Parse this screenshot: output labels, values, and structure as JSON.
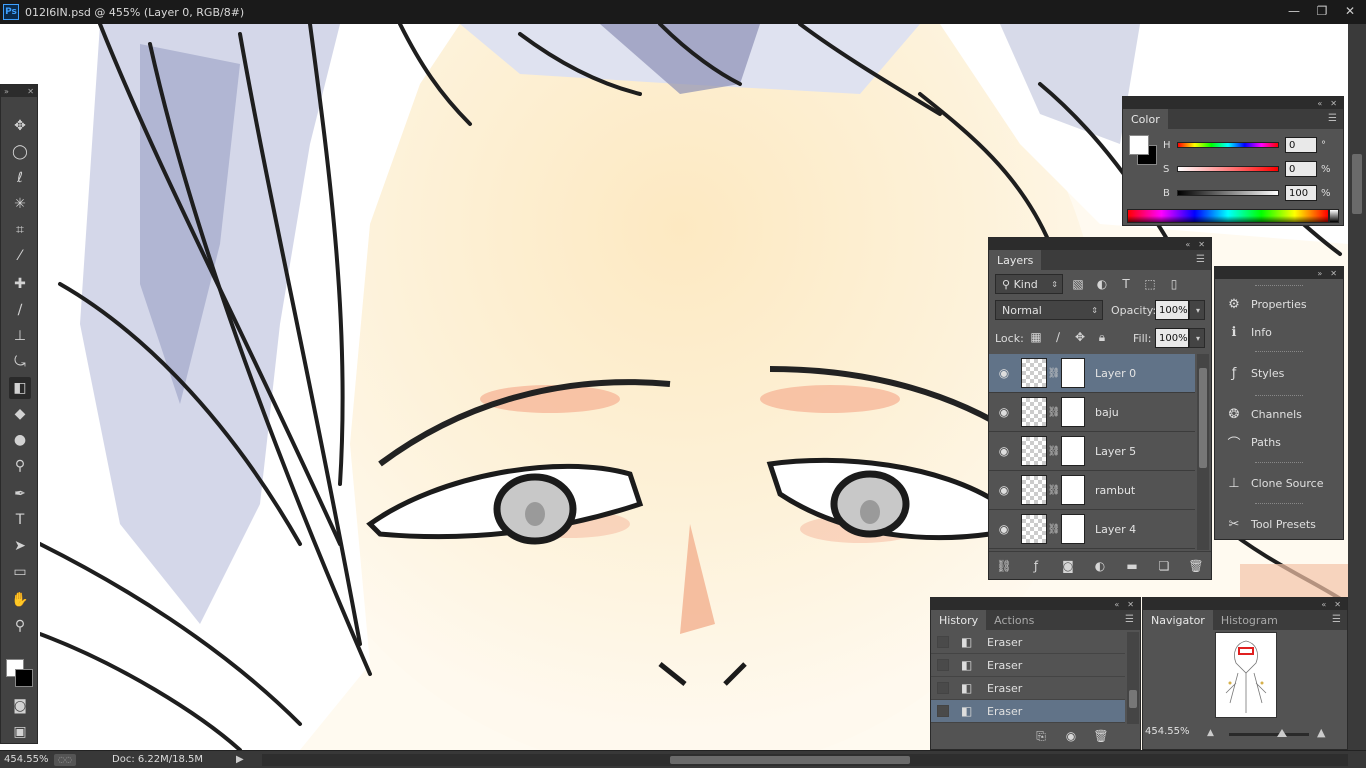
{
  "app": {
    "icon_label": "Ps",
    "doc_title": "012I6IN.psd @ 455% (Layer 0, RGB/8#)"
  },
  "window_controls": {
    "minimize": "—",
    "restore": "❐",
    "close": "✕"
  },
  "status": {
    "zoom": "454.55%",
    "doc_size": "Doc: 6.22M/18.5M",
    "arrow": "▶",
    "left_arrow": "◀"
  },
  "toolbar": {
    "tools": [
      {
        "icon": "move-icon",
        "glyph": "✥"
      },
      {
        "icon": "marquee-icon",
        "glyph": "◯"
      },
      {
        "icon": "lasso-icon",
        "glyph": "ℓ"
      },
      {
        "icon": "magic-wand-icon",
        "glyph": "✳"
      },
      {
        "icon": "crop-icon",
        "glyph": "⌗"
      },
      {
        "icon": "eyedropper-icon",
        "glyph": "⁄"
      },
      {
        "icon": "healing-brush-icon",
        "glyph": "✚"
      },
      {
        "icon": "brush-icon",
        "glyph": "∕"
      },
      {
        "icon": "clone-stamp-icon",
        "glyph": "⊥"
      },
      {
        "icon": "history-brush-icon",
        "glyph": "⤿"
      },
      {
        "icon": "eraser-icon",
        "glyph": "◧"
      },
      {
        "icon": "paint-bucket-icon",
        "glyph": "◆"
      },
      {
        "icon": "blur-icon",
        "glyph": "●"
      },
      {
        "icon": "dodge-icon",
        "glyph": "⚲"
      },
      {
        "icon": "pen-icon",
        "glyph": "✒"
      },
      {
        "icon": "type-icon",
        "glyph": "T"
      },
      {
        "icon": "path-selection-icon",
        "glyph": "➤"
      },
      {
        "icon": "rectangle-icon",
        "glyph": "▭"
      },
      {
        "icon": "hand-icon",
        "glyph": "✋"
      },
      {
        "icon": "zoom-icon",
        "glyph": "⚲"
      },
      {
        "icon": "quick-mask-icon",
        "glyph": "◙"
      },
      {
        "icon": "screen-mode-icon",
        "glyph": "▣"
      }
    ],
    "active_tool": "eraser-icon"
  },
  "color_panel": {
    "tab": "Color",
    "sliders": [
      {
        "label": "H",
        "value": "0",
        "unit": "°"
      },
      {
        "label": "S",
        "value": "0",
        "unit": "%"
      },
      {
        "label": "B",
        "value": "100",
        "unit": "%"
      }
    ]
  },
  "layers_panel": {
    "tab": "Layers",
    "filter_kind": "Kind",
    "blend_mode": "Normal",
    "opacity_label": "Opacity:",
    "opacity_value": "100%",
    "lock_label": "Lock:",
    "fill_label": "Fill:",
    "fill_value": "100%",
    "layers": [
      {
        "name": "Layer 0",
        "selected": true
      },
      {
        "name": "baju",
        "selected": false
      },
      {
        "name": "Layer 5",
        "selected": false
      },
      {
        "name": "rambut",
        "selected": false
      },
      {
        "name": "Layer 4",
        "selected": false
      }
    ]
  },
  "dock": {
    "items": [
      {
        "label": "Properties",
        "icon": "properties-icon",
        "glyph": "⚙"
      },
      {
        "label": "Info",
        "icon": "info-icon",
        "glyph": "ℹ"
      },
      {
        "label": "Styles",
        "icon": "styles-icon",
        "glyph": "ƒ"
      },
      {
        "label": "Channels",
        "icon": "channels-icon",
        "glyph": "❂"
      },
      {
        "label": "Paths",
        "icon": "paths-icon",
        "glyph": "⌒"
      },
      {
        "label": "Clone Source",
        "icon": "clone-source-icon",
        "glyph": "⊥"
      },
      {
        "label": "Tool Presets",
        "icon": "tool-presets-icon",
        "glyph": "✂"
      }
    ]
  },
  "history_panel": {
    "tabs": [
      "History",
      "Actions"
    ],
    "states": [
      {
        "label": "Eraser",
        "selected": false
      },
      {
        "label": "Eraser",
        "selected": false
      },
      {
        "label": "Eraser",
        "selected": false
      },
      {
        "label": "Eraser",
        "selected": true
      }
    ]
  },
  "navigator_panel": {
    "tabs": [
      "Navigator",
      "Histogram"
    ],
    "zoom": "454.55%"
  }
}
